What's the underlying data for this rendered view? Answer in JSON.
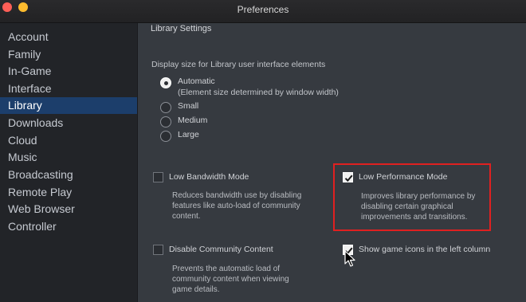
{
  "window": {
    "title": "Preferences"
  },
  "sidebar": {
    "items": [
      {
        "label": "Account"
      },
      {
        "label": "Family"
      },
      {
        "label": "In-Game"
      },
      {
        "label": "Interface"
      },
      {
        "label": "Library",
        "active": true
      },
      {
        "label": "Downloads"
      },
      {
        "label": "Cloud"
      },
      {
        "label": "Music"
      },
      {
        "label": "Broadcasting"
      },
      {
        "label": "Remote Play"
      },
      {
        "label": "Web Browser"
      },
      {
        "label": "Controller"
      }
    ]
  },
  "main": {
    "section_title": "Library Settings",
    "display_size": {
      "label": "Display size for Library user interface elements",
      "options": [
        {
          "label": "Automatic",
          "selected": true
        },
        {
          "label": "Small",
          "selected": false
        },
        {
          "label": "Medium",
          "selected": false
        },
        {
          "label": "Large",
          "selected": false
        }
      ],
      "automatic_desc": "(Element size determined by window width)"
    },
    "options": {
      "low_bandwidth": {
        "label": "Low Bandwidth Mode",
        "checked": false,
        "desc": [
          "Reduces bandwidth use by disabling",
          "features like auto-load of community",
          "content."
        ]
      },
      "low_performance": {
        "label": "Low Performance Mode",
        "checked": true,
        "desc": [
          "Improves library performance by",
          "disabling certain graphical",
          "improvements and transitions."
        ]
      },
      "disable_community": {
        "label": "Disable Community Content",
        "checked": false,
        "desc": [
          "Prevents the automatic load of",
          "community content when viewing",
          "game details."
        ]
      },
      "game_icons": {
        "label": "Show game icons in the left column",
        "checked": true
      }
    }
  },
  "colors": {
    "accent": "#1c3e6b",
    "highlight": "#e02020"
  }
}
